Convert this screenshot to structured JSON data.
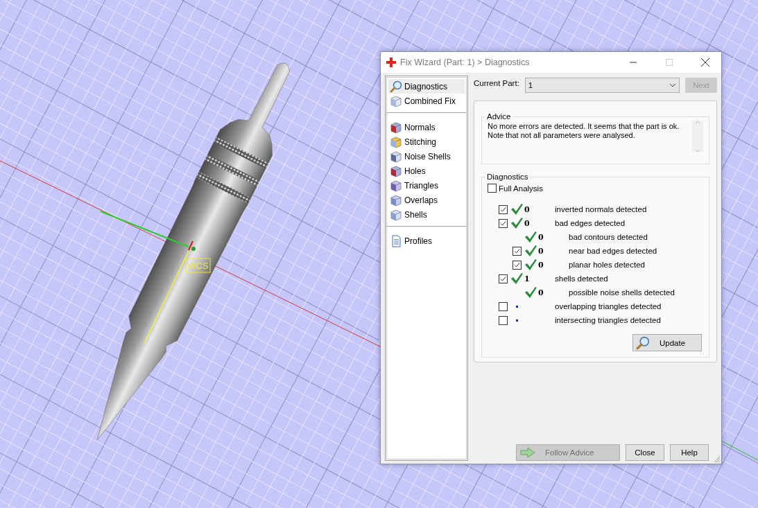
{
  "viewport": {
    "label": "WCS"
  },
  "window": {
    "title": "Fix Wizard (Part: 1) > Diagnostics"
  },
  "sidebar": {
    "groups": [
      {
        "items": [
          {
            "label": "Diagnostics",
            "selected": true
          },
          {
            "label": "Combined Fix",
            "selected": false
          }
        ]
      },
      {
        "items": [
          {
            "label": "Normals",
            "selected": false
          },
          {
            "label": "Stitching",
            "selected": false
          },
          {
            "label": "Noise Shells",
            "selected": false
          },
          {
            "label": "Holes",
            "selected": false
          },
          {
            "label": "Triangles",
            "selected": false
          },
          {
            "label": "Overlaps",
            "selected": false
          },
          {
            "label": "Shells",
            "selected": false
          }
        ]
      },
      {
        "items": [
          {
            "label": "Profiles",
            "selected": false
          }
        ]
      }
    ]
  },
  "current_part": {
    "label": "Current Part:",
    "value": "1",
    "next_button": {
      "label": "Next",
      "disabled": true
    }
  },
  "advice": {
    "title": "Advice",
    "lines": [
      "No more errors are detected. It seems that the part is ok.",
      "Note that not all parameters were analysed."
    ]
  },
  "diagnostics": {
    "title": "Diagnostics",
    "full_analysis": {
      "label": "Full Analysis",
      "checked": false
    },
    "rows": [
      {
        "checked": true,
        "kind": "ok",
        "count": "0",
        "label": "inverted normals detected"
      },
      {
        "checked": true,
        "kind": "ok",
        "count": "0",
        "label": "bad edges detected",
        "children": [
          {
            "kind": "ok",
            "count": "0",
            "label": "bad contours detected"
          },
          {
            "checked": true,
            "kind": "ok",
            "count": "0",
            "label": "near bad edges detected"
          },
          {
            "checked": true,
            "kind": "ok",
            "count": "0",
            "label": "planar holes detected"
          }
        ]
      },
      {
        "checked": true,
        "kind": "ok",
        "count": "1",
        "label": "shells detected",
        "children": [
          {
            "kind": "ok",
            "count": "0",
            "label": "possible noise shells detected"
          }
        ]
      },
      {
        "checked": false,
        "kind": "pending",
        "label": "overlapping triangles detected"
      },
      {
        "checked": false,
        "kind": "pending",
        "label": "intersecting triangles detected"
      }
    ],
    "update_button": {
      "label": "Update"
    }
  },
  "buttons": [
    {
      "kind": "follow",
      "label": "Follow Advice",
      "disabled": true
    },
    {
      "kind": "plain",
      "label": "Close",
      "disabled": false
    },
    {
      "kind": "plain",
      "label": "Help",
      "disabled": false
    }
  ]
}
